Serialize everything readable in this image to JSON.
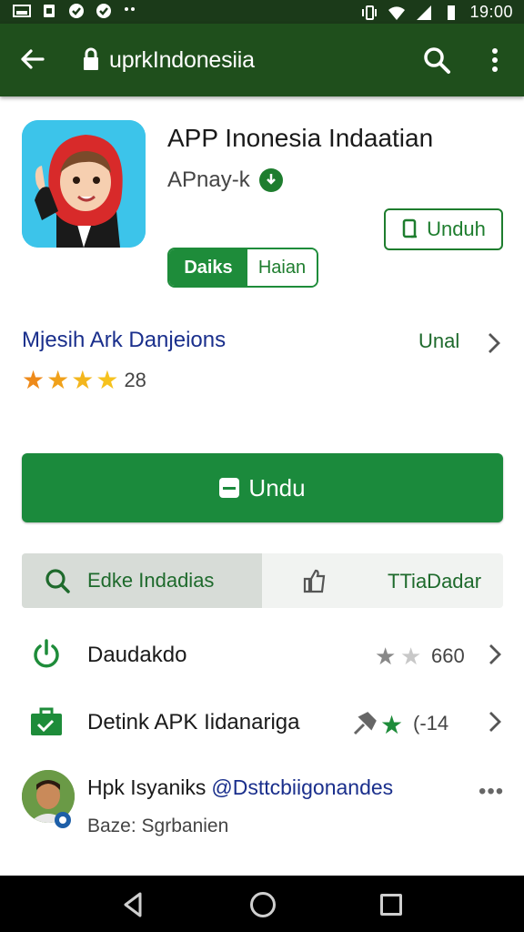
{
  "status_bar": {
    "time": "19:00",
    "left_icons": [
      "image-icon",
      "sim-icon",
      "check-circle-icon",
      "check-circle-icon",
      "dots-icon"
    ],
    "right_icons": [
      "vibrate-icon",
      "wifi-icon",
      "signal-icon",
      "battery-icon"
    ]
  },
  "app_bar": {
    "url": "uprkIndonesiia",
    "icons": [
      "back-arrow-icon",
      "lock-icon",
      "search-icon",
      "more-vert-icon"
    ]
  },
  "app": {
    "title": "APP Inonesia Indaatian",
    "developer": "APnay-k",
    "outline_button_label": "Unduh",
    "seg_active": "Daiks",
    "seg_inactive": "Haian"
  },
  "info": {
    "title": "Mjesih Ark Danjeions",
    "link": "Unal",
    "rating_count": "28",
    "stars_filled": 4
  },
  "big_button": {
    "label": "Undu"
  },
  "tabs": [
    {
      "label": "Edke Indadias",
      "icon": "search-icon"
    },
    {
      "label": "TTiaDadar",
      "icon": "thumbs-up-icon"
    }
  ],
  "list_rows": [
    {
      "label": "Daudakdo",
      "value": "660",
      "icon": "power-icon"
    },
    {
      "label": "Detink APK Iidanariga",
      "value": "(-14",
      "icon": "briefcase-icon"
    }
  ],
  "comment": {
    "name": "Hpk Isyaniks",
    "handle": "@Dsttcbiigonandes",
    "sub": "Baze: Sgrbanien",
    "more": "•••"
  },
  "colors": {
    "app_bar": "#1f4f1c",
    "status_bar": "#1b3a19",
    "primary_green": "#1b8a3c",
    "link_blue": "#1a2f8c",
    "star_orange": "#f0a11b"
  }
}
